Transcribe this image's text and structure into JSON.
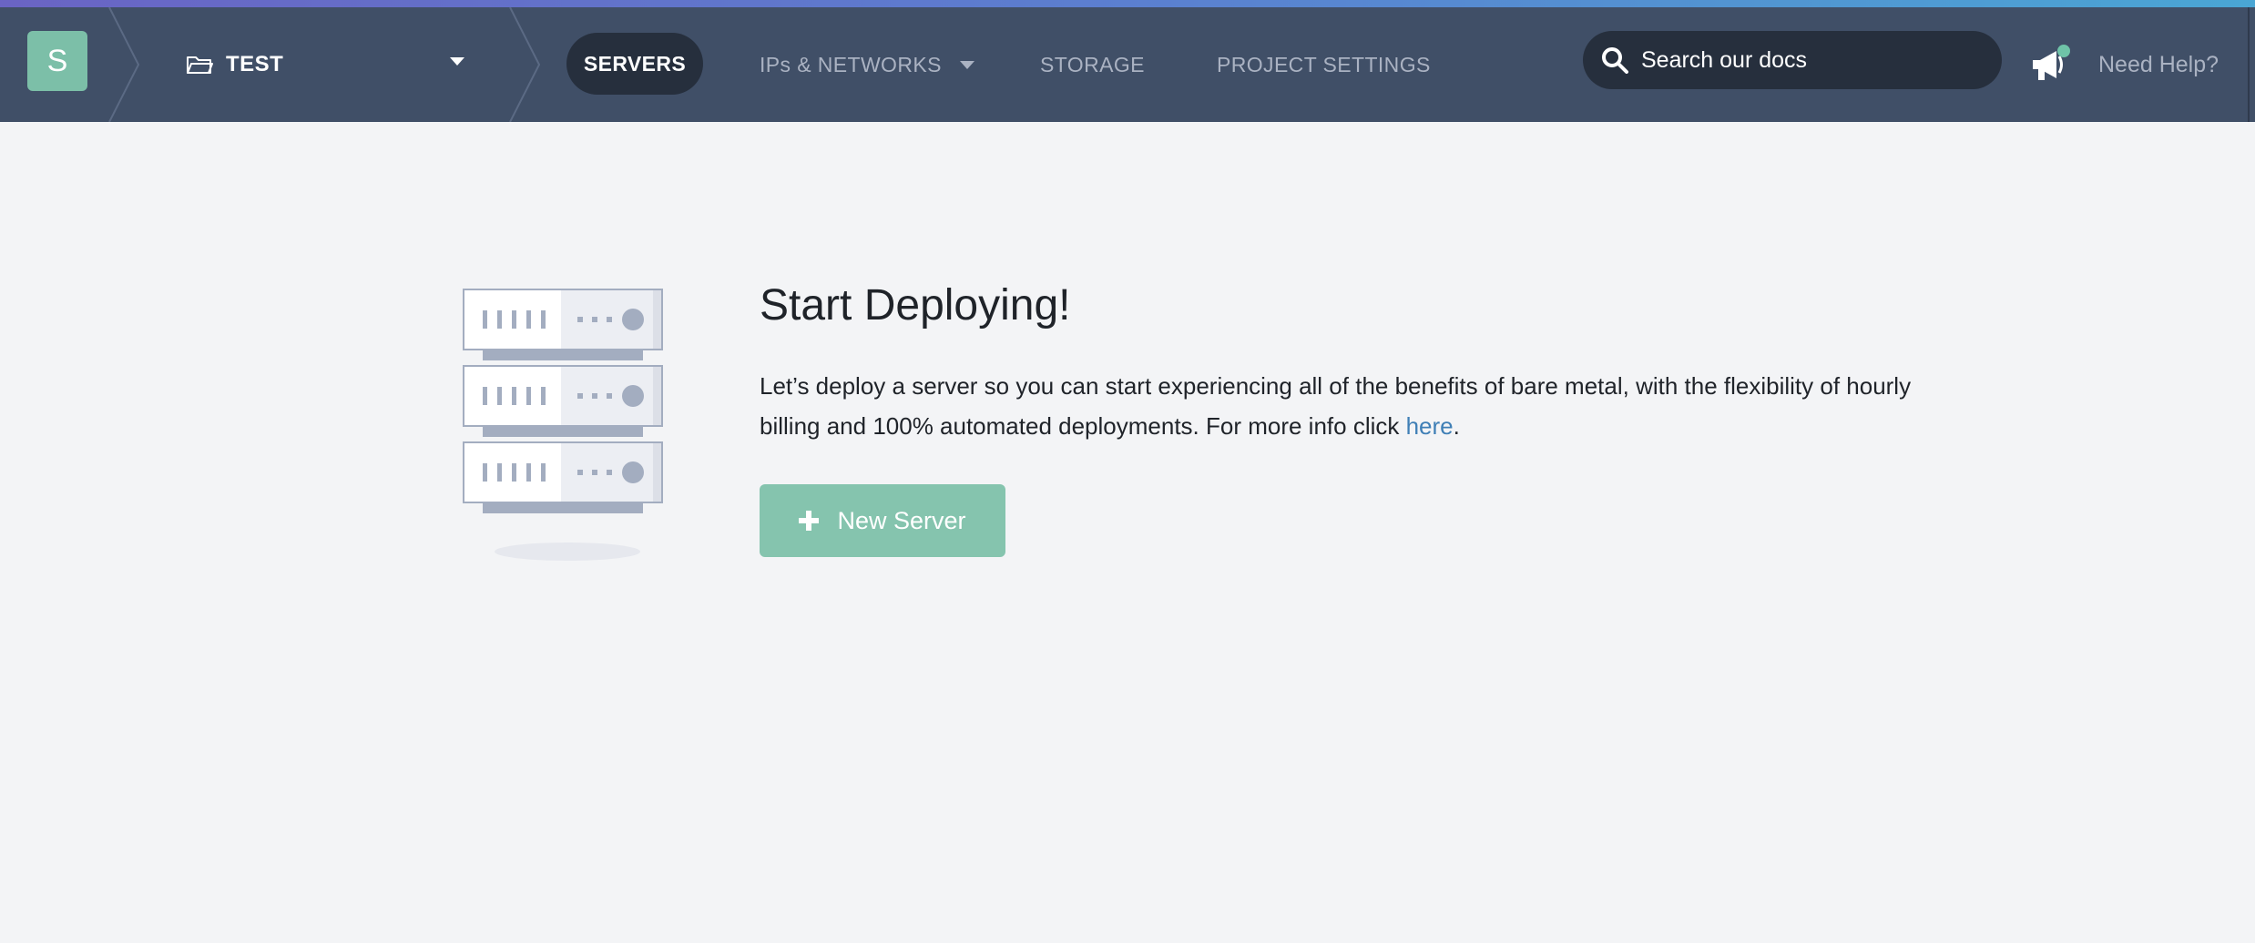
{
  "colors": {
    "navbar": "#404f67",
    "nav_active_bg": "#262f3d",
    "accent_green": "#85c4ae",
    "avatar_green": "#7cbfa8",
    "link_blue": "#3f7fb6",
    "page_bg": "#f3f4f6"
  },
  "header": {
    "avatar_letter": "S",
    "project": {
      "name": "TEST",
      "icon": "folder-icon",
      "dropdown_icon": "caret-down-icon"
    },
    "nav": [
      {
        "label": "SERVERS",
        "active": true
      },
      {
        "label": "IPs & NETWORKS",
        "active": false,
        "has_dropdown": true
      },
      {
        "label": "STORAGE",
        "active": false
      },
      {
        "label": "PROJECT SETTINGS",
        "active": false
      }
    ],
    "search": {
      "placeholder": "Search our docs",
      "value": "",
      "icon": "search-icon"
    },
    "announcements_icon": "megaphone-icon",
    "help_label": "Need Help?"
  },
  "main": {
    "illustration_icon": "server-rack-icon",
    "title": "Start Deploying!",
    "description": "Let’s deploy a server so you can start experiencing all of the benefits of bare metal, with the flexibility of hourly billing and 100% automated deployments. For more info click ",
    "link_text": "here",
    "description_end": ".",
    "new_server_button": "New Server",
    "new_server_icon": "plus-icon"
  }
}
